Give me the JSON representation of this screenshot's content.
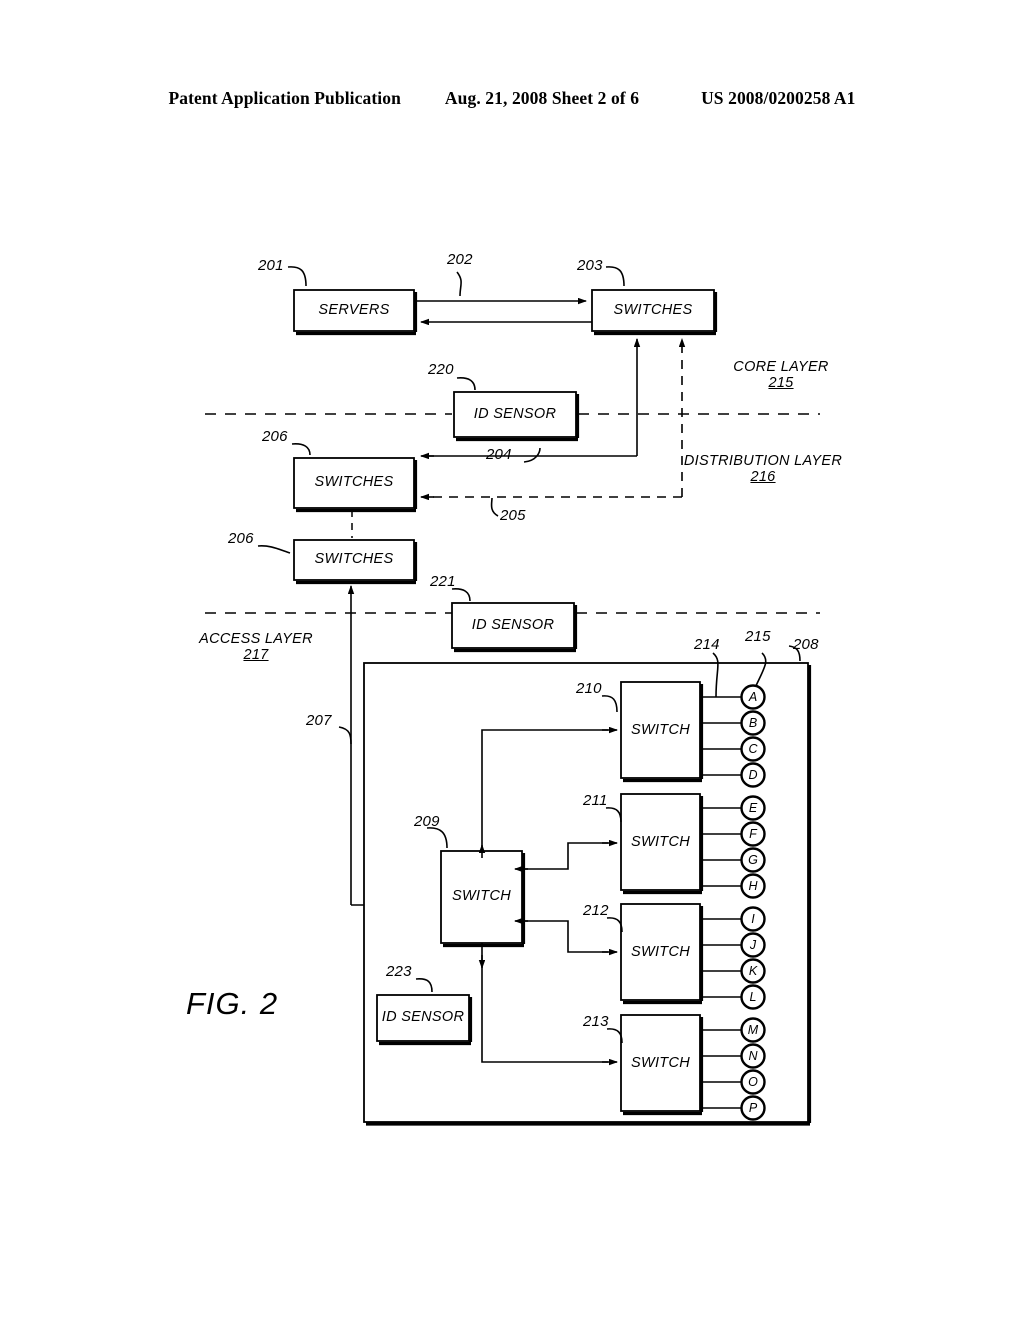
{
  "header": {
    "publication": "Patent Application Publication",
    "date_sheet": "Aug. 21, 2008  Sheet 2 of 6",
    "patent_number": "US 2008/0200258 A1"
  },
  "figure": {
    "caption": "FIG. 2",
    "layers": [
      {
        "name": "CORE LAYER",
        "ref": "215"
      },
      {
        "name": "DISTRIBUTION LAYER",
        "ref": "216"
      },
      {
        "name": "ACCESS LAYER",
        "ref": "217"
      }
    ],
    "blocks": [
      {
        "id": "servers",
        "label": "SERVERS",
        "ref": "201"
      },
      {
        "id": "core-switches",
        "label": "SWITCHES",
        "ref": "203"
      },
      {
        "id": "id-sensor-220",
        "label": "ID SENSOR",
        "ref": "220"
      },
      {
        "id": "dist-switches-upper",
        "label": "SWITCHES",
        "ref": "206"
      },
      {
        "id": "dist-switches-lower",
        "label": "SWITCHES",
        "ref": "206"
      },
      {
        "id": "id-sensor-221",
        "label": "ID SENSOR",
        "ref": "221"
      },
      {
        "id": "switch-209",
        "label": "SWITCH",
        "ref": "209"
      },
      {
        "id": "switch-210",
        "label": "SWITCH",
        "ref": "210"
      },
      {
        "id": "switch-211",
        "label": "SWITCH",
        "ref": "211"
      },
      {
        "id": "switch-212",
        "label": "SWITCH",
        "ref": "212"
      },
      {
        "id": "switch-213",
        "label": "SWITCH",
        "ref": "213"
      },
      {
        "id": "id-sensor-223",
        "label": "ID SENSOR",
        "ref": "223"
      },
      {
        "id": "access-enclosure",
        "label": "",
        "ref": "208"
      }
    ],
    "link_refs": [
      {
        "id": "link-202",
        "ref": "202"
      },
      {
        "id": "link-204",
        "ref": "204"
      },
      {
        "id": "link-205",
        "ref": "205"
      },
      {
        "id": "link-207",
        "ref": "207"
      },
      {
        "id": "link-214",
        "ref": "214"
      },
      {
        "id": "link-215-port",
        "ref": "215"
      }
    ],
    "ports": [
      "A",
      "B",
      "C",
      "D",
      "E",
      "F",
      "G",
      "H",
      "I",
      "J",
      "K",
      "L",
      "M",
      "N",
      "O",
      "P"
    ]
  }
}
